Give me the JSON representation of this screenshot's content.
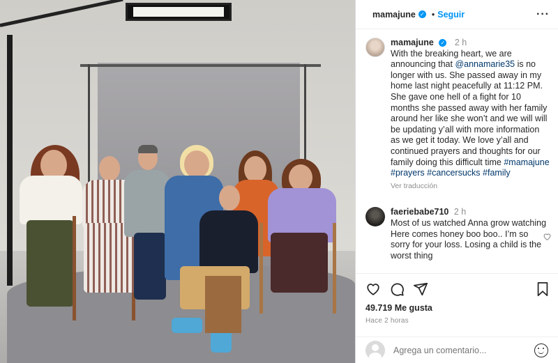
{
  "header": {
    "username": "mamajune",
    "follow_label": "Seguir",
    "more_icon": "ellipsis-icon"
  },
  "post": {
    "username": "mamajune",
    "time": "2 h",
    "caption_pre": "With the breaking heart, we are announcing that ",
    "mention": "@annamarie35",
    "caption_post": " is no longer with us. She passed away in my home last night peacefully at 11:12 PM. She gave one hell of a fight for 10 months she passed away with her family around her like she won’t and we will will be updating y’all with more information as we get it today. We love y’all and continued prayers and thoughts for our family doing this difficult time ",
    "hashtags": [
      "#mamajune",
      "#prayers",
      "#cancersucks",
      "#family"
    ],
    "translate_label": "Ver traducción"
  },
  "comment": {
    "username": "faeriebabe710",
    "time": "2 h",
    "text": "Most of us watched Anna grow watching Here comes honey boo boo.. I’m so sorry for your loss. Losing a child is the worst thing"
  },
  "actions": {
    "likes": "49.719 Me gusta",
    "posted_ago": "Hace 2 horas",
    "icons": [
      "heart-icon",
      "comment-icon",
      "share-icon",
      "bookmark-icon"
    ]
  },
  "add_comment": {
    "placeholder": "Agrega un comentario..."
  },
  "colors": {
    "accent": "#0095f6",
    "link": "#00376b",
    "muted": "#8e8e8e",
    "text": "#262626"
  }
}
